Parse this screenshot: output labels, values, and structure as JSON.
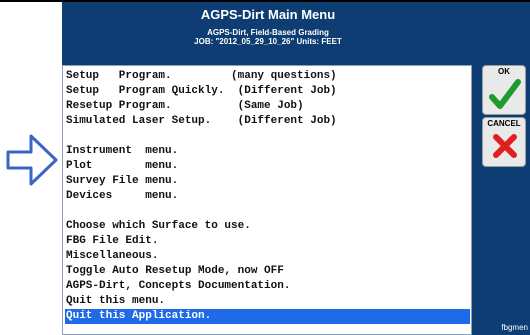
{
  "window": {
    "title": "AGPS-Dirt  Main Menu",
    "subtitle": "AGPS-Dirt, Field-Based Grading",
    "job_line": "JOB: \"2012_05_29_10_26\"  Units: FEET",
    "footer": "fbgmen"
  },
  "menu": {
    "items": [
      "Setup   Program.         (many questions)",
      "Setup   Program Quickly.  (Different Job)",
      "Resetup Program.          (Same Job)",
      "Simulated Laser Setup.    (Different Job)",
      "",
      "Instrument  menu.",
      "Plot        menu.",
      "Survey File menu.",
      "Devices     menu.",
      "",
      "Choose which Surface to use.",
      "FBG File Edit.",
      "Miscellaneous.",
      "Toggle Auto Resetup Mode, now OFF",
      "AGPS-Dirt, Concepts Documentation.",
      "Quit this menu.",
      "Quit this Application."
    ],
    "selected": "Quit this Application."
  },
  "buttons": {
    "ok_label": "OK",
    "cancel_label": "CANCEL"
  },
  "icons": {
    "pointer": "right-arrow-icon",
    "ok": "checkmark-icon",
    "cancel": "x-icon"
  },
  "colors": {
    "panel": "#0d3d73",
    "selection": "#1e6ae8",
    "ok_check": "#1f9a2e",
    "cancel_x": "#e02020",
    "arrow": "#3a64c8"
  }
}
